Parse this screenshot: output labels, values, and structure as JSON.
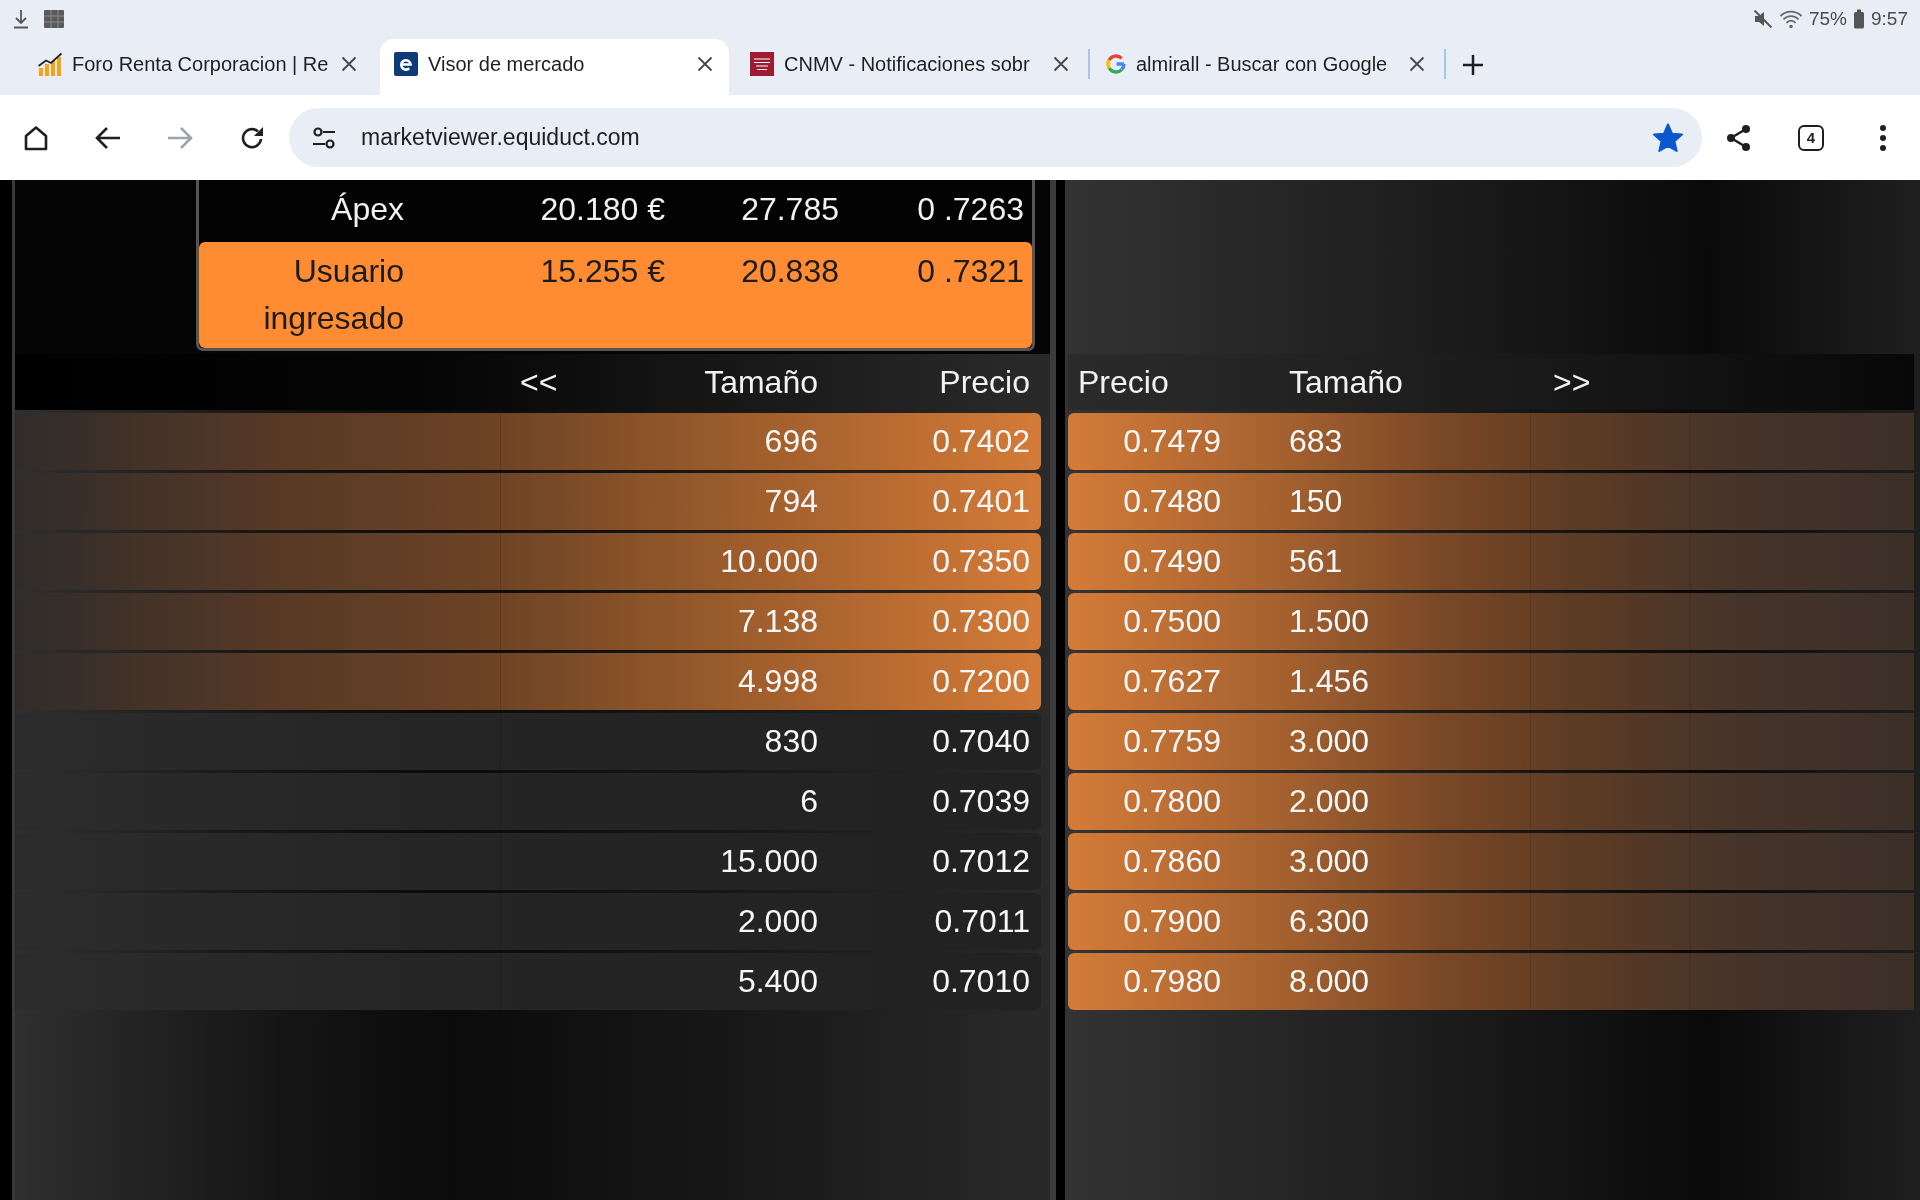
{
  "status_bar": {
    "battery": "75%",
    "time": "9:57"
  },
  "tabs": [
    {
      "title": "Foro Renta Corporacion | Re",
      "kind": "chart",
      "selected": false
    },
    {
      "title": "Visor de mercado",
      "kind": "letter",
      "selected": true
    },
    {
      "title": "CNMV - Notificaciones sobr",
      "kind": "crest",
      "selected": false
    },
    {
      "title": "almirall - Buscar con Google",
      "kind": "ring",
      "selected": false
    }
  ],
  "toolbar": {
    "forward": {
      "disabled": true
    },
    "url": "marketviewer.equiduct.com",
    "bookmarked": true,
    "tab_count": "4"
  },
  "summary": {
    "rows": [
      {
        "cells": [
          "Ápex",
          "20.180 €",
          "27.785",
          "0 .7263"
        ],
        "highlighted": false
      },
      {
        "cells": [
          "Usuario ingresado",
          "15.255 €",
          "20.838",
          "0 .7321"
        ],
        "highlighted": true
      }
    ]
  },
  "order_book": {
    "bids": {
      "columns": [
        {
          "label": "<<",
          "kind": "nav"
        },
        {
          "label": "Tamaño",
          "kind": "heading"
        },
        {
          "label": "Precio",
          "kind": "heading"
        }
      ],
      "rows": [
        {
          "size": "696",
          "price": "0.7402",
          "highlighted": true
        },
        {
          "size": "794",
          "price": "0.7401",
          "highlighted": true
        },
        {
          "size": "10.000",
          "price": "0.7350",
          "highlighted": true
        },
        {
          "size": "7.138",
          "price": "0.7300",
          "highlighted": true
        },
        {
          "size": "4.998",
          "price": "0.7200",
          "highlighted": true
        },
        {
          "size": "830",
          "price": "0.7040",
          "highlighted": false
        },
        {
          "size": "6",
          "price": "0.7039",
          "highlighted": false
        },
        {
          "size": "15.000",
          "price": "0.7012",
          "highlighted": false
        },
        {
          "size": "2.000",
          "price": "0.7011",
          "highlighted": false
        },
        {
          "size": "5.400",
          "price": "0.7010",
          "highlighted": false
        }
      ]
    },
    "asks": {
      "columns": [
        {
          "label": "Precio",
          "kind": "heading"
        },
        {
          "label": "Tamaño",
          "kind": "heading"
        },
        {
          "label": ">>",
          "kind": "nav"
        }
      ],
      "rows": [
        {
          "price": "0.7479",
          "size": "683",
          "highlighted": true
        },
        {
          "price": "0.7480",
          "size": "150",
          "highlighted": true
        },
        {
          "price": "0.7490",
          "size": "561",
          "highlighted": true
        },
        {
          "price": "0.7500",
          "size": "1.500",
          "highlighted": true
        },
        {
          "price": "0.7627",
          "size": "1.456",
          "highlighted": true
        },
        {
          "price": "0.7759",
          "size": "3.000",
          "highlighted": true
        },
        {
          "price": "0.7800",
          "size": "2.000",
          "highlighted": true
        },
        {
          "price": "0.7860",
          "size": "3.000",
          "highlighted": true
        },
        {
          "price": "0.7900",
          "size": "6.300",
          "highlighted": true
        },
        {
          "price": "0.7980",
          "size": "8.000",
          "highlighted": true
        }
      ]
    }
  }
}
